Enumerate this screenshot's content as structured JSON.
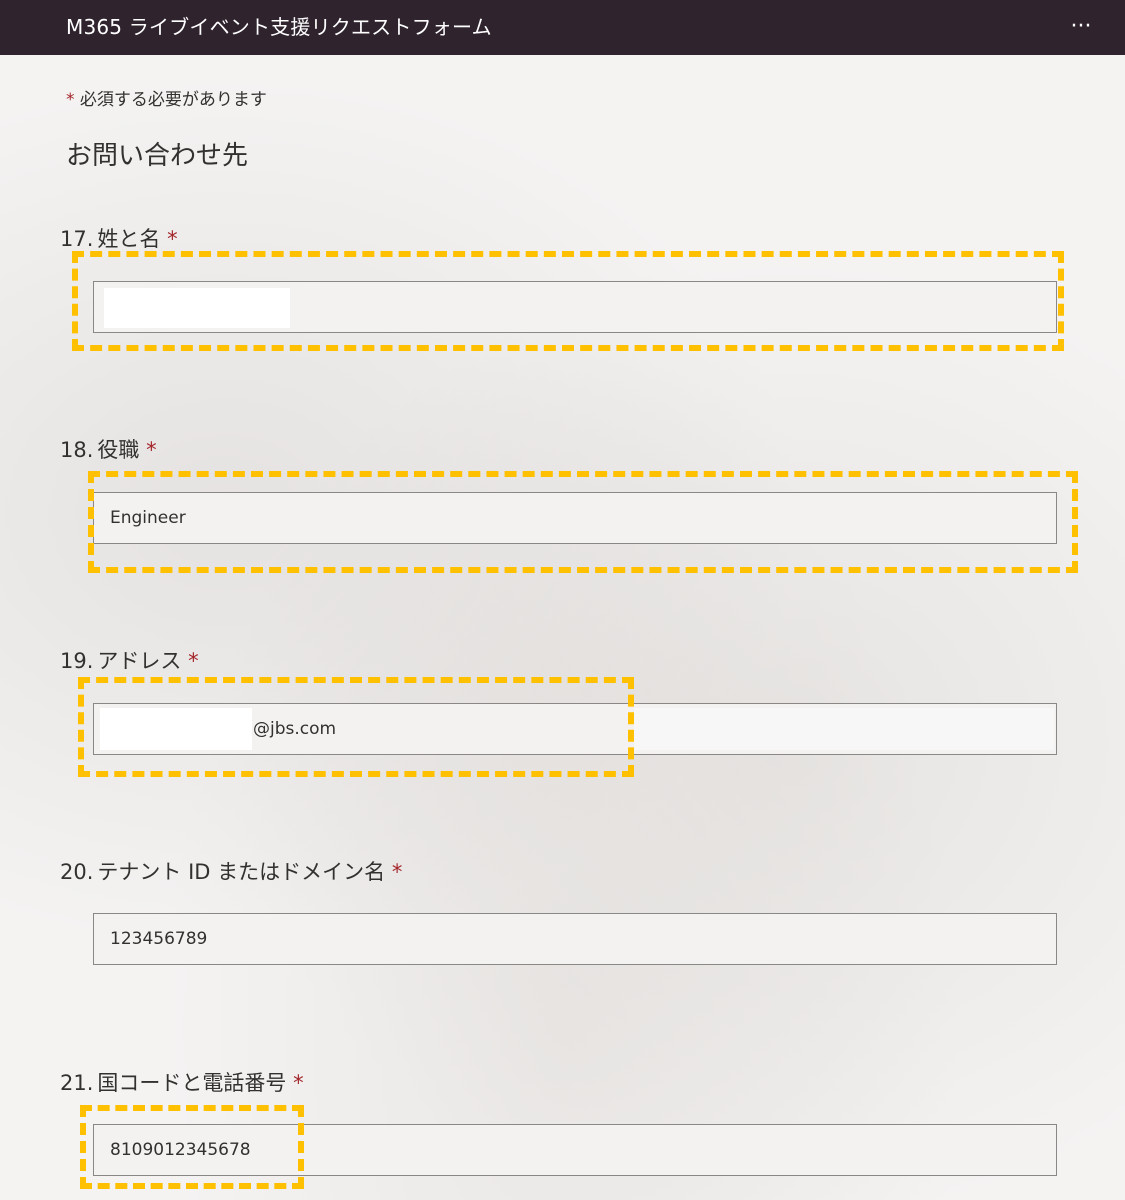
{
  "header": {
    "title": "M365 ライブイベント支援リクエストフォーム",
    "more_icon": "ellipsis-icon",
    "more_glyph": "···"
  },
  "form": {
    "required_star": "*",
    "required_note": "必須する必要があります",
    "section_title": "お問い合わせ先",
    "questions": [
      {
        "number": "17.",
        "label": "姓と名",
        "required": "*",
        "value": ""
      },
      {
        "number": "18.",
        "label": "役職",
        "required": "*",
        "value": "Engineer"
      },
      {
        "number": "19.",
        "label": "アドレス",
        "required": "*",
        "value": "@jbs.com"
      },
      {
        "number": "20.",
        "label": "テナント ID またはドメイン名",
        "required": "*",
        "value": "123456789"
      },
      {
        "number": "21.",
        "label": "国コードと電話番号",
        "required": "*",
        "value": "8109012345678"
      }
    ]
  },
  "colors": {
    "header_bg": "#2f232e",
    "required": "#a4262c",
    "highlight": "#ffc000"
  }
}
